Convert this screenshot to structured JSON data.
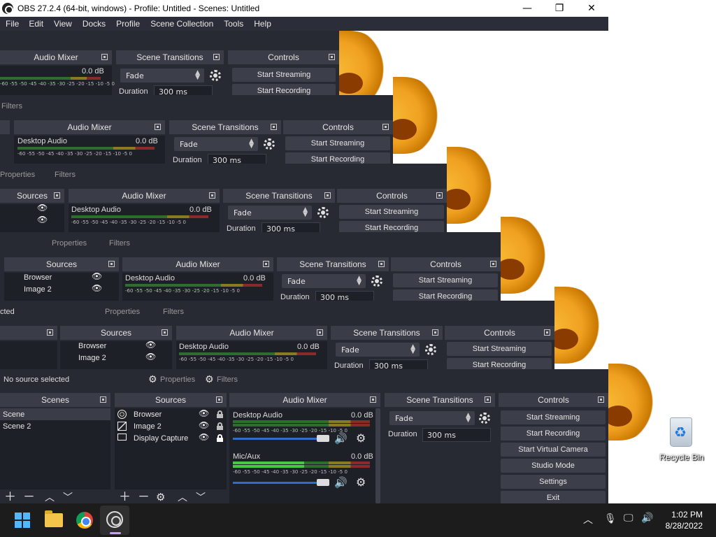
{
  "window": {
    "title": "OBS 27.2.4 (64-bit, windows) - Profile: Untitled - Scenes: Untitled",
    "minimize_glyph": "—",
    "maximize_glyph": "❐",
    "close_glyph": "✕"
  },
  "menu": [
    "File",
    "Edit",
    "View",
    "Docks",
    "Profile",
    "Scene Collection",
    "Tools",
    "Help"
  ],
  "docks": {
    "scenes": "Scenes",
    "sources": "Sources",
    "audio_mixer": "Audio Mixer",
    "scene_transitions": "Scene Transitions",
    "controls": "Controls"
  },
  "status": {
    "no_source": "No source selected",
    "no_source_partial": "cted",
    "properties": "Properties",
    "filters": "Filters"
  },
  "scenes": [
    "Scene",
    "Scene 2"
  ],
  "sources": [
    {
      "name": "Browser",
      "icon": "globe-icon"
    },
    {
      "name": "Image 2",
      "icon": "image-icon"
    },
    {
      "name": "Display Capture",
      "icon": "monitor-icon"
    }
  ],
  "audio": {
    "desktop_label": "Desktop Audio",
    "desktop_db": "0.0 dB",
    "mic_label": "Mic/Aux",
    "mic_db": "0.0 dB",
    "scale": "-60 -55 -50 -45 -40 -35 -30 -25 -20 -15 -10 -5  0"
  },
  "transitions": {
    "selected": "Fade",
    "duration_label": "Duration",
    "duration_value": "300 ms"
  },
  "controls": [
    "Start Streaming",
    "Start Recording",
    "Start Virtual Camera",
    "Studio Mode",
    "Settings",
    "Exit"
  ],
  "desktop": {
    "recycle_bin": "Recycle Bin"
  },
  "taskbar": {
    "time": "1:02 PM",
    "date": "8/28/2022"
  },
  "colors": {
    "panel_bg": "#272a33",
    "dock_header": "#3a3d47",
    "button": "#3c3f4a",
    "slider": "#2d6fc4"
  }
}
